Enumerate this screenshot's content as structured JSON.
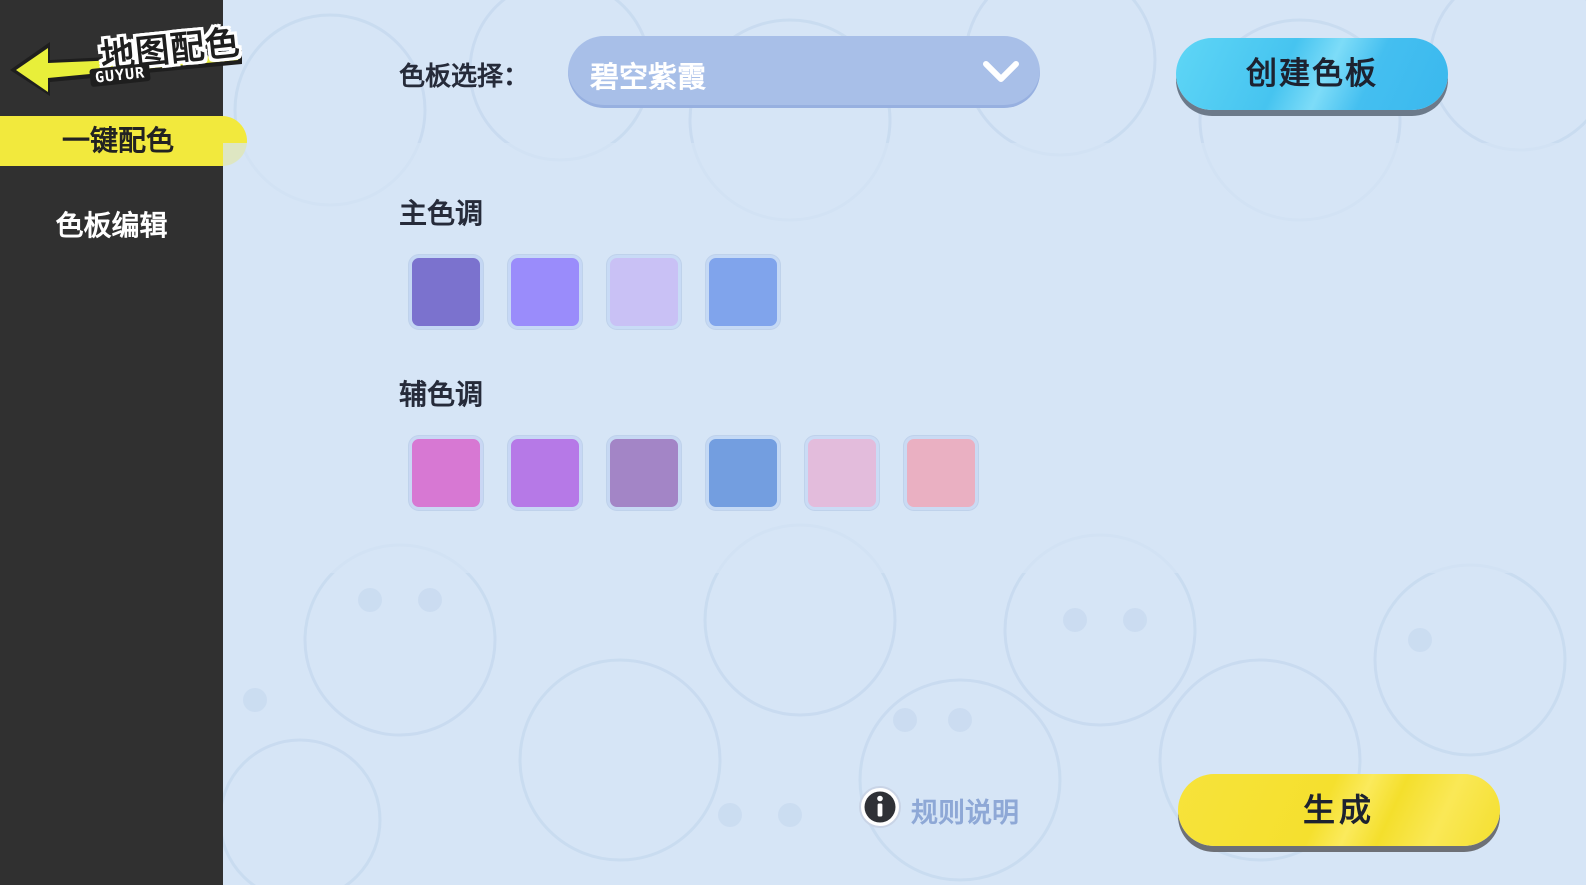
{
  "logo": {
    "title": "地图配色",
    "subtitle": "GUYUR"
  },
  "sidebar": {
    "items": [
      {
        "label": "一键配色",
        "active": true
      },
      {
        "label": "色板编辑",
        "active": false
      }
    ]
  },
  "header": {
    "selector_label": "色板选择：",
    "selected_palette": "碧空紫霞",
    "create_button": "创建色板"
  },
  "palette": {
    "primary": {
      "title": "主色调",
      "colors": [
        "#7b72ce",
        "#9a8cfb",
        "#c9c1f5",
        "#80a4ec"
      ]
    },
    "secondary": {
      "title": "辅色调",
      "colors": [
        "#d778d3",
        "#b679e7",
        "#a385c6",
        "#739ee0",
        "#e3bcdc",
        "#eab0c2"
      ]
    }
  },
  "footer": {
    "rules_label": "规则说明",
    "generate_button": "生成"
  },
  "colors": {
    "sidebar_bg": "#303030",
    "nav_active": "#f2e93d",
    "page_bg": "#d6e5f6",
    "create_button": "#46c4f0",
    "generate_button": "#f5e02e",
    "dropdown": "#a8bfe8"
  }
}
